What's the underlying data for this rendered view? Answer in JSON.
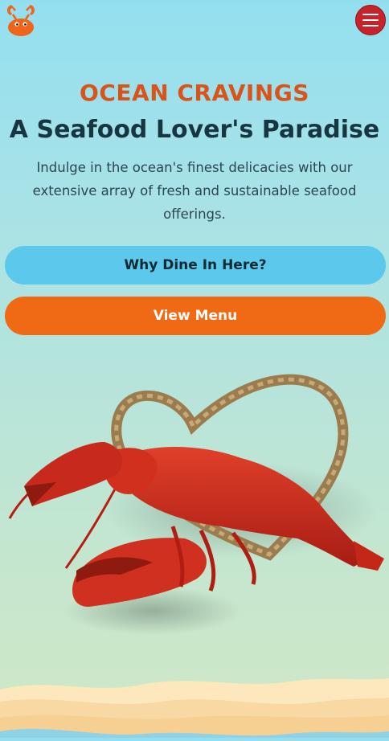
{
  "header": {
    "logo_icon": "crab-icon",
    "menu_icon": "hamburger-menu-icon",
    "brand_color": "#f0651a",
    "menu_button_color": "#c8232b"
  },
  "hero": {
    "eyebrow": "OCEAN CRAVINGS",
    "title": "A Seafood Lover's Paradise",
    "description": "Indulge in the ocean's finest delicacies with our extensive array of fresh and sustainable seafood offerings."
  },
  "buttons": {
    "why_dine": "Why Dine In Here?",
    "view_menu": "View Menu"
  },
  "colors": {
    "eyebrow": "#d9531a",
    "headline": "#173641",
    "why_button": "#5bc8ec",
    "menu_button": "#f06a16"
  },
  "hero_image": {
    "subject": "red-lobster-with-rope-heart"
  }
}
